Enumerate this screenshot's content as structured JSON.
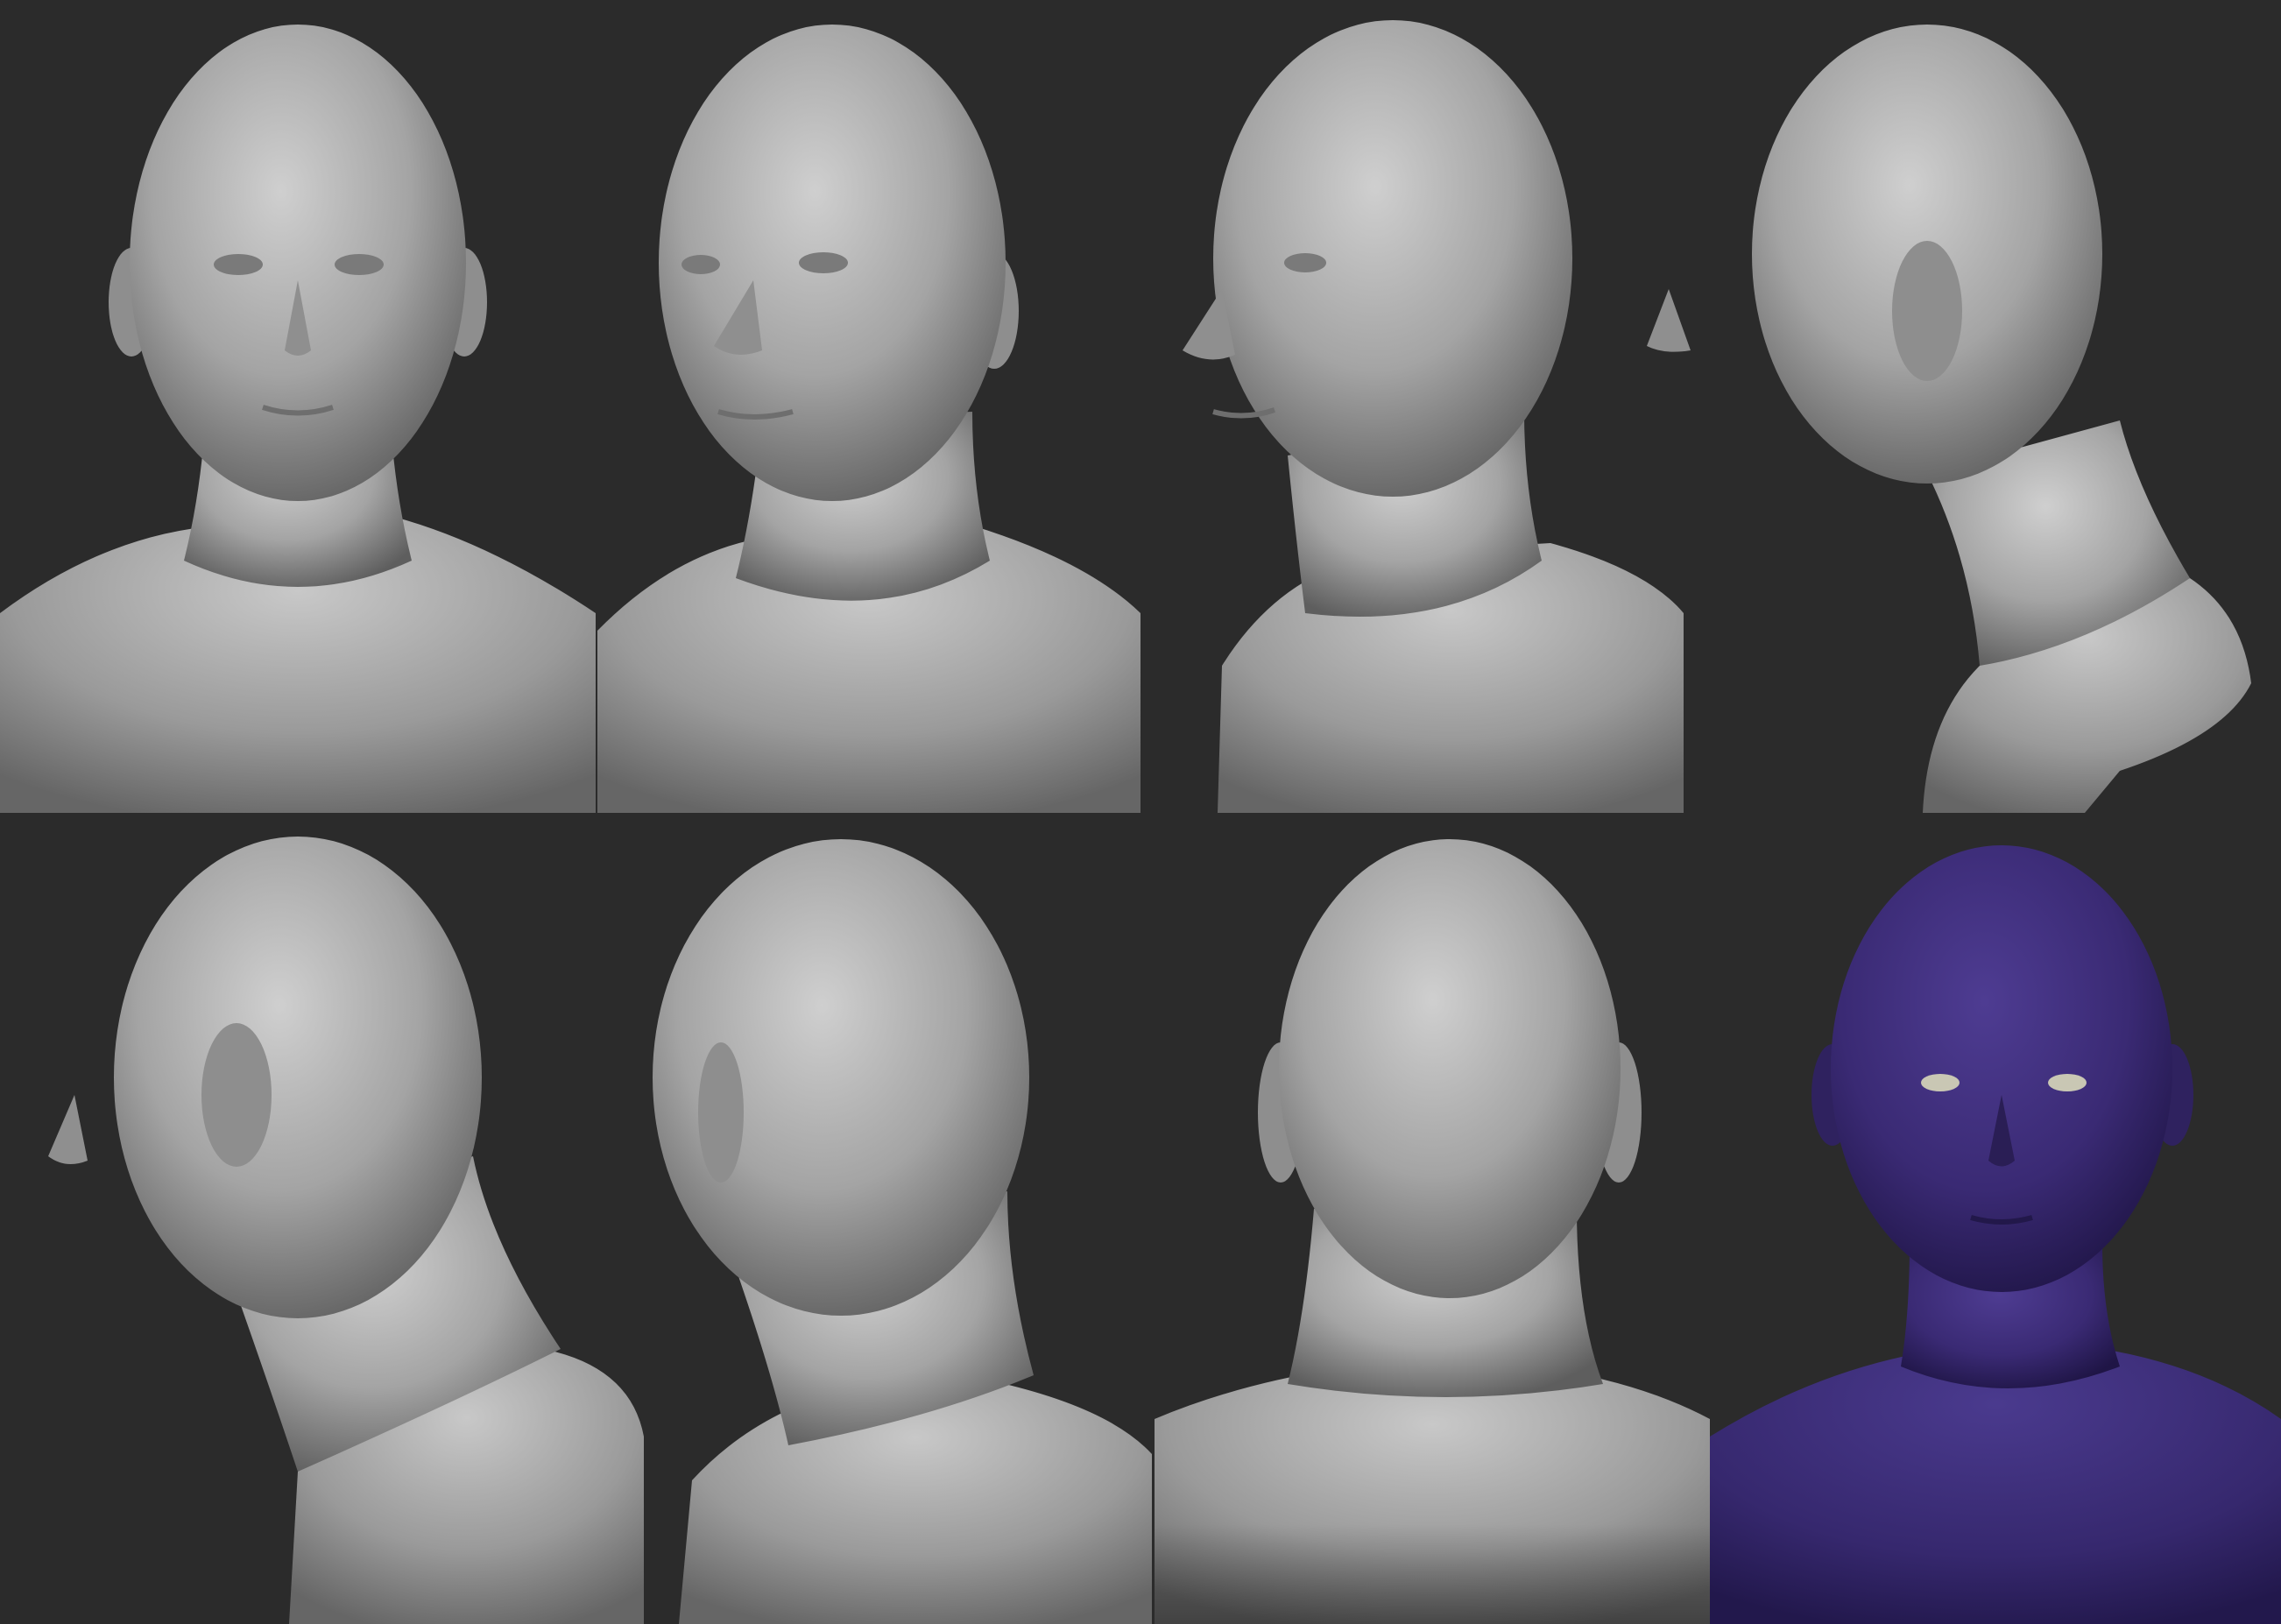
{
  "sheet": {
    "background_color": "#2b2b2b",
    "clay_color": "#a9a9a9",
    "polypaint_color": "#3c2c78"
  },
  "panels": [
    {
      "name": "front-view",
      "shading": "clay"
    },
    {
      "name": "three-quarter-right-view",
      "shading": "clay"
    },
    {
      "name": "strong-three-quarter-right-view",
      "shading": "clay"
    },
    {
      "name": "right-profile-view",
      "shading": "clay"
    },
    {
      "name": "left-rear-three-quarter-view",
      "shading": "clay"
    },
    {
      "name": "rear-left-view",
      "shading": "clay"
    },
    {
      "name": "back-view",
      "shading": "clay"
    },
    {
      "name": "front-polypaint-view",
      "shading": "polypaint"
    }
  ]
}
